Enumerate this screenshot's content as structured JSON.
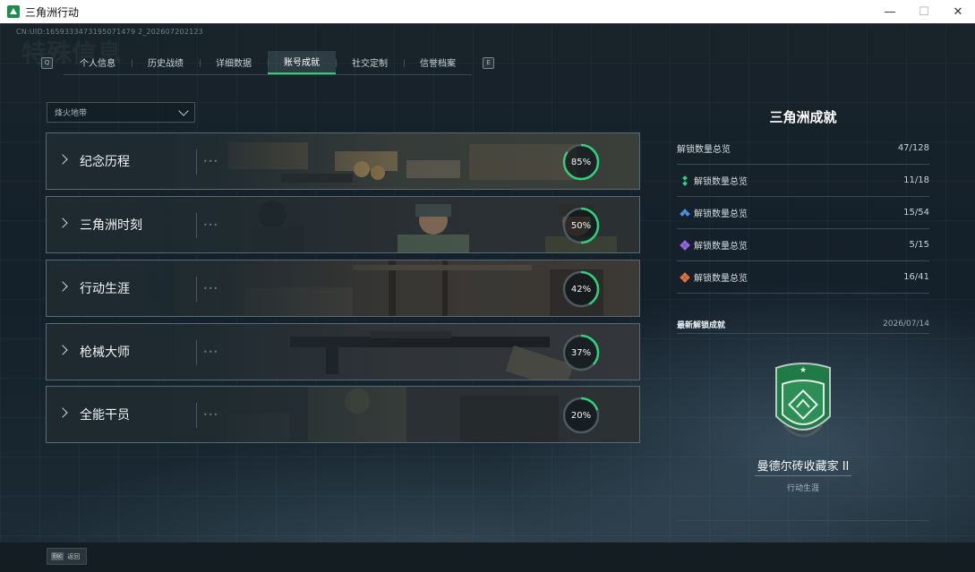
{
  "window": {
    "title": "三角洲行动",
    "controls": {
      "minimize": "—",
      "maximize": "☐",
      "close": "✕"
    }
  },
  "header": {
    "uid": "CN:UID:1659333473195071479 2_202607202123",
    "ghost_text": "特殊信息",
    "prev_key": "Q",
    "next_key": "E"
  },
  "tabs": [
    {
      "label": "个人信息",
      "active": false
    },
    {
      "label": "历史战绩",
      "active": false
    },
    {
      "label": "详细数据",
      "active": false
    },
    {
      "label": "账号成就",
      "active": true
    },
    {
      "label": "社交定制",
      "active": false
    },
    {
      "label": "信誉档案",
      "active": false
    }
  ],
  "filter": {
    "selected": "烽火地带"
  },
  "categories": [
    {
      "name": "纪念历程",
      "percent": 85,
      "percent_label": "85%"
    },
    {
      "name": "三角洲时刻",
      "percent": 50,
      "percent_label": "50%"
    },
    {
      "name": "行动生涯",
      "percent": 42,
      "percent_label": "42%"
    },
    {
      "name": "枪械大师",
      "percent": 37,
      "percent_label": "37%"
    },
    {
      "name": "全能干员",
      "percent": 20,
      "percent_label": "20%"
    }
  ],
  "panel": {
    "title": "三角洲成就",
    "summary": {
      "label": "解锁数量总览",
      "value": "47/128"
    },
    "tiers": [
      {
        "label": "解锁数量总览",
        "value": "11/18",
        "color": "#2ecf8a"
      },
      {
        "label": "解锁数量总览",
        "value": "15/54",
        "color": "#4b8fe0"
      },
      {
        "label": "解锁数量总览",
        "value": "5/15",
        "color": "#9a63e6"
      },
      {
        "label": "解锁数量总览",
        "value": "16/41",
        "color": "#e0733a"
      }
    ],
    "latest": {
      "label": "最新解锁成就",
      "date": "2026/07/14",
      "name": "曼德尔砖收藏家 II",
      "category": "行动生涯"
    }
  },
  "footer": {
    "esc_key": "Esc",
    "esc_label": "返回"
  },
  "colors": {
    "accent": "#2fd07c"
  }
}
